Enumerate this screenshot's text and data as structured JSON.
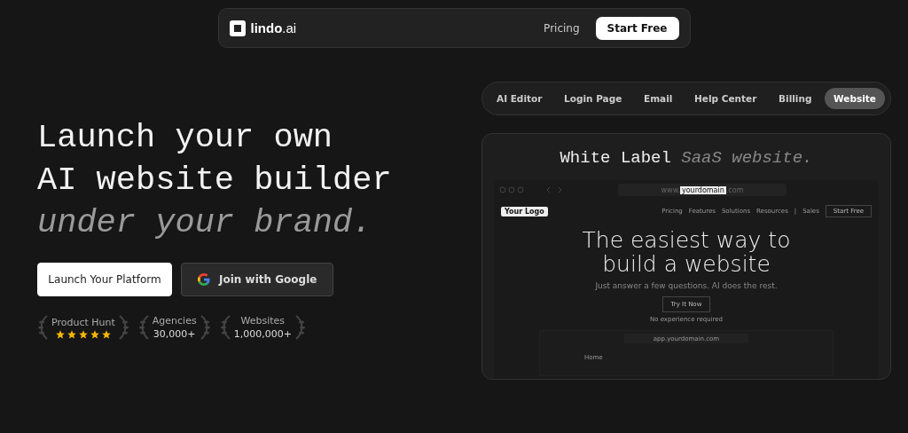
{
  "nav": {
    "logo": "lindo",
    "logo_suffix": ".ai",
    "links": [
      "Pricing"
    ],
    "cta": "Start Free"
  },
  "hero": {
    "title_lines": [
      "Launch your own",
      "AI website builder"
    ],
    "subtitle": "under your brand.",
    "buttons": [
      {
        "kind": "primary",
        "label": "Launch Your Platform"
      },
      {
        "kind": "google",
        "label": "Join with Google"
      }
    ],
    "badges": [
      {
        "kind": "stars",
        "label": "Product Hunt",
        "stars": 5
      },
      {
        "kind": "count",
        "label": "Agencies",
        "value": "30,000+"
      },
      {
        "kind": "count",
        "label": "Websites",
        "value": "1,000,000+"
      }
    ]
  },
  "tabs": [
    {
      "label": "AI Editor",
      "selected": false
    },
    {
      "label": "Login Page",
      "selected": false
    },
    {
      "label": "Email",
      "selected": false
    },
    {
      "label": "Help Center",
      "selected": false
    },
    {
      "label": "Billing",
      "selected": false
    },
    {
      "label": "Website",
      "selected": true
    }
  ],
  "preview": {
    "title": "White Label",
    "title_italic": "SaaS website.",
    "browser": {
      "url_prefix": "www.",
      "url_domain": "yourdomain",
      "url_suffix": ".com"
    },
    "site": {
      "logo": "Your Logo",
      "links": [
        "Pricing",
        "Features",
        "Solutions",
        "Resources",
        "|",
        "Sales"
      ],
      "cta": "Start Free",
      "headline_lines": [
        "The easiest way to",
        "build a website"
      ],
      "subtext": "Just answer a few questions. AI does the rest.",
      "button": "Try It Now",
      "note": "No experience required"
    },
    "inner_browser": {
      "url": "app.yourdomain.com",
      "home": "Home"
    }
  }
}
